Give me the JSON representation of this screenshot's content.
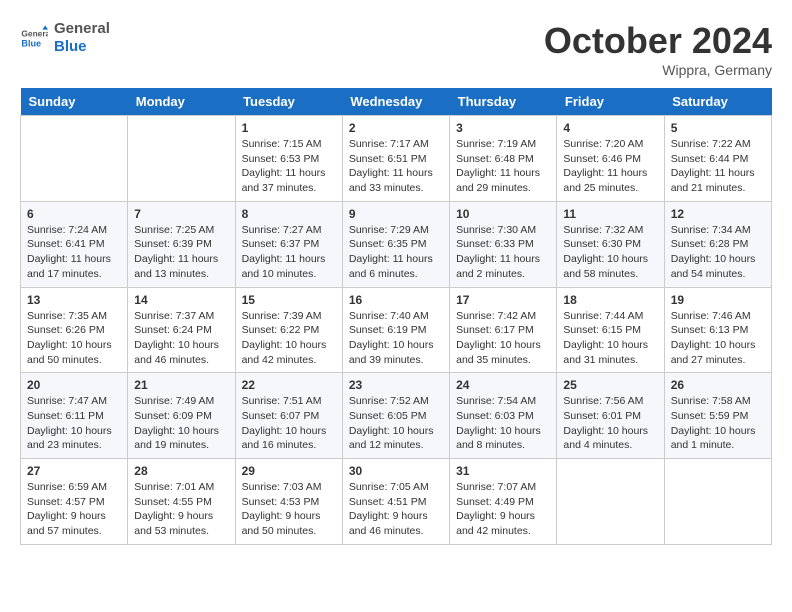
{
  "header": {
    "logo_general": "General",
    "logo_blue": "Blue",
    "month_title": "October 2024",
    "location": "Wippra, Germany"
  },
  "columns": [
    "Sunday",
    "Monday",
    "Tuesday",
    "Wednesday",
    "Thursday",
    "Friday",
    "Saturday"
  ],
  "weeks": [
    {
      "days": [
        {
          "num": "",
          "info": ""
        },
        {
          "num": "",
          "info": ""
        },
        {
          "num": "1",
          "info": "Sunrise: 7:15 AM\nSunset: 6:53 PM\nDaylight: 11 hours\nand 37 minutes."
        },
        {
          "num": "2",
          "info": "Sunrise: 7:17 AM\nSunset: 6:51 PM\nDaylight: 11 hours\nand 33 minutes."
        },
        {
          "num": "3",
          "info": "Sunrise: 7:19 AM\nSunset: 6:48 PM\nDaylight: 11 hours\nand 29 minutes."
        },
        {
          "num": "4",
          "info": "Sunrise: 7:20 AM\nSunset: 6:46 PM\nDaylight: 11 hours\nand 25 minutes."
        },
        {
          "num": "5",
          "info": "Sunrise: 7:22 AM\nSunset: 6:44 PM\nDaylight: 11 hours\nand 21 minutes."
        }
      ]
    },
    {
      "days": [
        {
          "num": "6",
          "info": "Sunrise: 7:24 AM\nSunset: 6:41 PM\nDaylight: 11 hours\nand 17 minutes."
        },
        {
          "num": "7",
          "info": "Sunrise: 7:25 AM\nSunset: 6:39 PM\nDaylight: 11 hours\nand 13 minutes."
        },
        {
          "num": "8",
          "info": "Sunrise: 7:27 AM\nSunset: 6:37 PM\nDaylight: 11 hours\nand 10 minutes."
        },
        {
          "num": "9",
          "info": "Sunrise: 7:29 AM\nSunset: 6:35 PM\nDaylight: 11 hours\nand 6 minutes."
        },
        {
          "num": "10",
          "info": "Sunrise: 7:30 AM\nSunset: 6:33 PM\nDaylight: 11 hours\nand 2 minutes."
        },
        {
          "num": "11",
          "info": "Sunrise: 7:32 AM\nSunset: 6:30 PM\nDaylight: 10 hours\nand 58 minutes."
        },
        {
          "num": "12",
          "info": "Sunrise: 7:34 AM\nSunset: 6:28 PM\nDaylight: 10 hours\nand 54 minutes."
        }
      ]
    },
    {
      "days": [
        {
          "num": "13",
          "info": "Sunrise: 7:35 AM\nSunset: 6:26 PM\nDaylight: 10 hours\nand 50 minutes."
        },
        {
          "num": "14",
          "info": "Sunrise: 7:37 AM\nSunset: 6:24 PM\nDaylight: 10 hours\nand 46 minutes."
        },
        {
          "num": "15",
          "info": "Sunrise: 7:39 AM\nSunset: 6:22 PM\nDaylight: 10 hours\nand 42 minutes."
        },
        {
          "num": "16",
          "info": "Sunrise: 7:40 AM\nSunset: 6:19 PM\nDaylight: 10 hours\nand 39 minutes."
        },
        {
          "num": "17",
          "info": "Sunrise: 7:42 AM\nSunset: 6:17 PM\nDaylight: 10 hours\nand 35 minutes."
        },
        {
          "num": "18",
          "info": "Sunrise: 7:44 AM\nSunset: 6:15 PM\nDaylight: 10 hours\nand 31 minutes."
        },
        {
          "num": "19",
          "info": "Sunrise: 7:46 AM\nSunset: 6:13 PM\nDaylight: 10 hours\nand 27 minutes."
        }
      ]
    },
    {
      "days": [
        {
          "num": "20",
          "info": "Sunrise: 7:47 AM\nSunset: 6:11 PM\nDaylight: 10 hours\nand 23 minutes."
        },
        {
          "num": "21",
          "info": "Sunrise: 7:49 AM\nSunset: 6:09 PM\nDaylight: 10 hours\nand 19 minutes."
        },
        {
          "num": "22",
          "info": "Sunrise: 7:51 AM\nSunset: 6:07 PM\nDaylight: 10 hours\nand 16 minutes."
        },
        {
          "num": "23",
          "info": "Sunrise: 7:52 AM\nSunset: 6:05 PM\nDaylight: 10 hours\nand 12 minutes."
        },
        {
          "num": "24",
          "info": "Sunrise: 7:54 AM\nSunset: 6:03 PM\nDaylight: 10 hours\nand 8 minutes."
        },
        {
          "num": "25",
          "info": "Sunrise: 7:56 AM\nSunset: 6:01 PM\nDaylight: 10 hours\nand 4 minutes."
        },
        {
          "num": "26",
          "info": "Sunrise: 7:58 AM\nSunset: 5:59 PM\nDaylight: 10 hours\nand 1 minute."
        }
      ]
    },
    {
      "days": [
        {
          "num": "27",
          "info": "Sunrise: 6:59 AM\nSunset: 4:57 PM\nDaylight: 9 hours\nand 57 minutes."
        },
        {
          "num": "28",
          "info": "Sunrise: 7:01 AM\nSunset: 4:55 PM\nDaylight: 9 hours\nand 53 minutes."
        },
        {
          "num": "29",
          "info": "Sunrise: 7:03 AM\nSunset: 4:53 PM\nDaylight: 9 hours\nand 50 minutes."
        },
        {
          "num": "30",
          "info": "Sunrise: 7:05 AM\nSunset: 4:51 PM\nDaylight: 9 hours\nand 46 minutes."
        },
        {
          "num": "31",
          "info": "Sunrise: 7:07 AM\nSunset: 4:49 PM\nDaylight: 9 hours\nand 42 minutes."
        },
        {
          "num": "",
          "info": ""
        },
        {
          "num": "",
          "info": ""
        }
      ]
    }
  ]
}
